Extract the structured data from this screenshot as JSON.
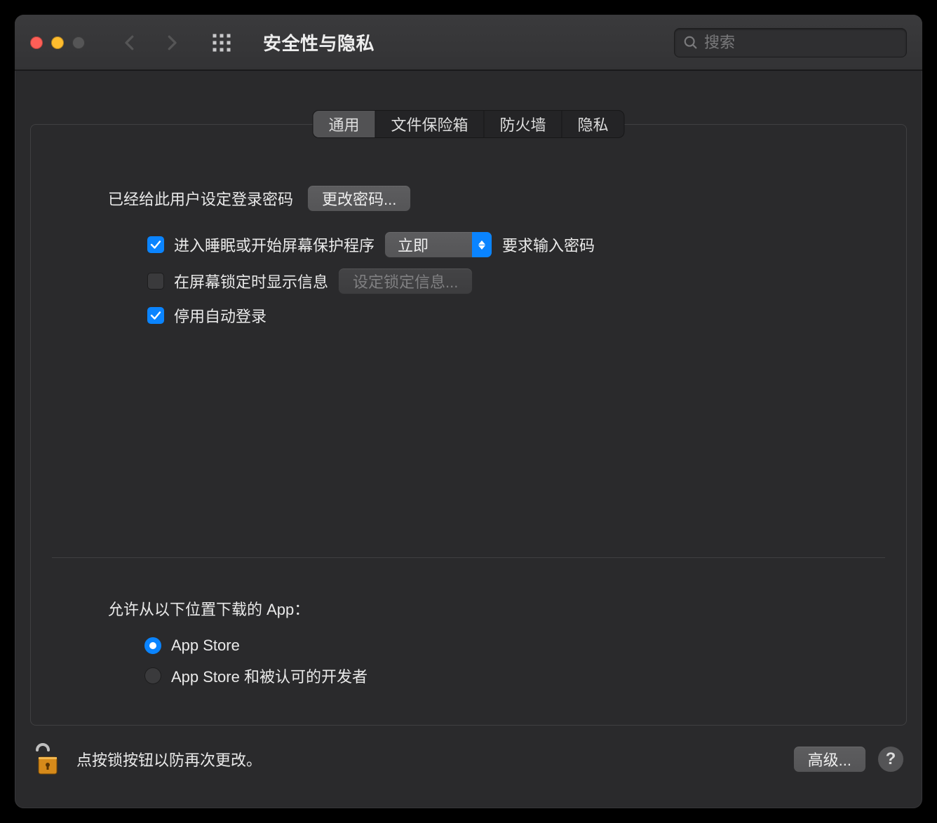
{
  "window": {
    "title": "安全性与隐私"
  },
  "search": {
    "placeholder": "搜索"
  },
  "tabs": {
    "general": "通用",
    "filevault": "文件保险箱",
    "firewall": "防火墙",
    "privacy": "隐私",
    "active": "general"
  },
  "general": {
    "password_set_label": "已经给此用户设定登录密码",
    "change_password_btn": "更改密码...",
    "require_pw_prefix": "进入睡眠或开始屏幕保护程序",
    "require_pw_delay": "立即",
    "require_pw_suffix": "要求输入密码",
    "require_pw_checked": true,
    "show_lock_msg_label": "在屏幕锁定时显示信息",
    "show_lock_msg_checked": false,
    "set_lock_msg_btn": "设定锁定信息...",
    "disable_autologin_label": "停用自动登录",
    "disable_autologin_checked": true,
    "allow_apps_label": "允许从以下位置下载的 App：",
    "allow_apps_option1": "App Store",
    "allow_apps_option2": "App Store 和被认可的开发者",
    "allow_apps_selected": "option1"
  },
  "footer": {
    "lock_text": "点按锁按钮以防再次更改。",
    "advanced_btn": "高级..."
  }
}
